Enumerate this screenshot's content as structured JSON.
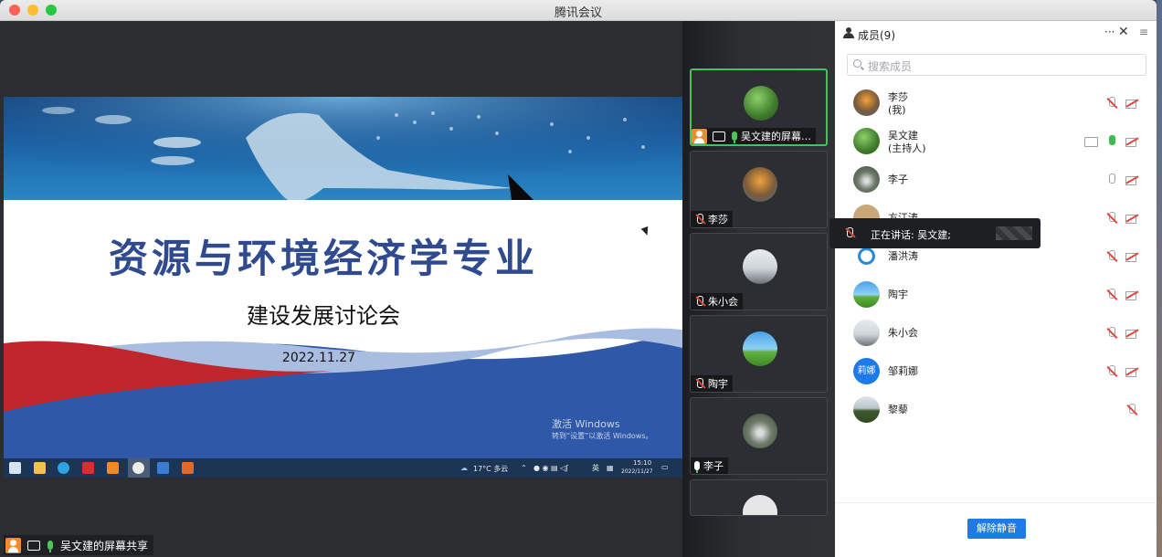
{
  "window": {
    "title": "腾讯会议"
  },
  "slide": {
    "title": "资源与环境经济学专业",
    "subtitle": "建设发展讨论会",
    "date": "2022.11.27",
    "activate_line1": "激活 Windows",
    "activate_line2": "转到“设置”以激活 Windows。"
  },
  "taskbar": {
    "weather": "17°C 多云",
    "ime": "英",
    "time": "15:10",
    "date": "2022/11/27"
  },
  "share_label": "吴文建的屏幕共享",
  "video_tiles": [
    {
      "name": "吴文建的屏幕…",
      "active": true
    },
    {
      "name": "李莎"
    },
    {
      "name": "朱小会"
    },
    {
      "name": "陶宇"
    },
    {
      "name": "李子"
    }
  ],
  "panel": {
    "title": "成员(9)",
    "more_label": "···",
    "close_label": "✕",
    "search_placeholder": "搜索成员",
    "unmute_label": "解除静音"
  },
  "members": [
    {
      "name": "李莎",
      "role": "(我)",
      "mic": "off",
      "camera": "off"
    },
    {
      "name": "吴文建",
      "role": "(主持人)",
      "mic": "on",
      "camera": "off",
      "sharing": true
    },
    {
      "name": "李子",
      "mic": "idle",
      "camera": "off"
    },
    {
      "name": "方江涛",
      "mic": "off",
      "camera": "off"
    },
    {
      "name": "潘洪涛",
      "mic": "off",
      "camera": "off"
    },
    {
      "name": "陶宇",
      "mic": "off",
      "camera": "off"
    },
    {
      "name": "朱小会",
      "mic": "off",
      "camera": "off"
    },
    {
      "name": "邹莉娜",
      "avatar_text": "莉娜",
      "mic": "off",
      "camera": "off"
    },
    {
      "name": "黎藜",
      "mic": "off"
    }
  ],
  "speaking": {
    "text": "正在讲话: 吴文建;"
  },
  "colors": {
    "accent": "#1e7ae6",
    "active_green": "#45c25c",
    "mute_red": "#e0453a"
  }
}
